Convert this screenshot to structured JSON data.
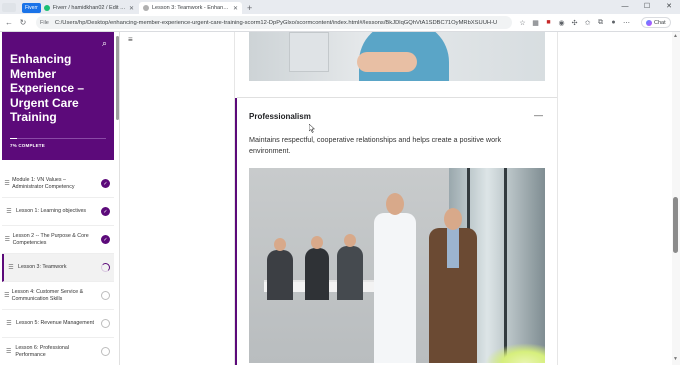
{
  "browser": {
    "tabs": [
      {
        "title": "Fiverr / hamidkhan02 / Edit Gig",
        "active": false,
        "badge": "Fiverr"
      },
      {
        "title": "Lesson 3: Teamwork - Enhancing",
        "active": true
      }
    ],
    "new_tab_icon": "plus-icon",
    "file_label": "File",
    "url": "C:/Users/hp/Desktop/enhancing-member-experience-urgent-care-training-scorm12-DpPyGlxo/scormcontent/index.html#/lessons/BkJDlqGQhVtA1SDBC71OyMRbXSUUH-U",
    "chat_label": "Chat"
  },
  "course": {
    "title": "Enhancing Member Experience – Urgent Care Training",
    "progress_text": "7% COMPLETE",
    "progress_fraction": 0.07,
    "lessons": [
      {
        "label": "Module 1: VN Values – Administrator Competency",
        "status": "done"
      },
      {
        "label": "Lesson 1: Learning objectives",
        "status": "done"
      },
      {
        "label": "Lesson 2 -- The Purpose & Core Competencies",
        "status": "done"
      },
      {
        "label": "Lesson 3: Teamwork",
        "status": "in-progress"
      },
      {
        "label": "Lesson 4: Customer Service & Communication Skills",
        "status": "not-started"
      },
      {
        "label": "Lesson 5: Revenue Management",
        "status": "not-started"
      },
      {
        "label": "Lesson 6: Professional Performance",
        "status": "not-started"
      }
    ]
  },
  "content": {
    "section_title": "Professionalism",
    "section_body": "Maintains respectful, cooperative relationships and helps create a positive work environment.",
    "collapse_symbol": "—"
  },
  "colors": {
    "brand_purple": "#5c0a7a",
    "sidebar_bg": "#ffffff",
    "page_bg": "#ffffff"
  }
}
